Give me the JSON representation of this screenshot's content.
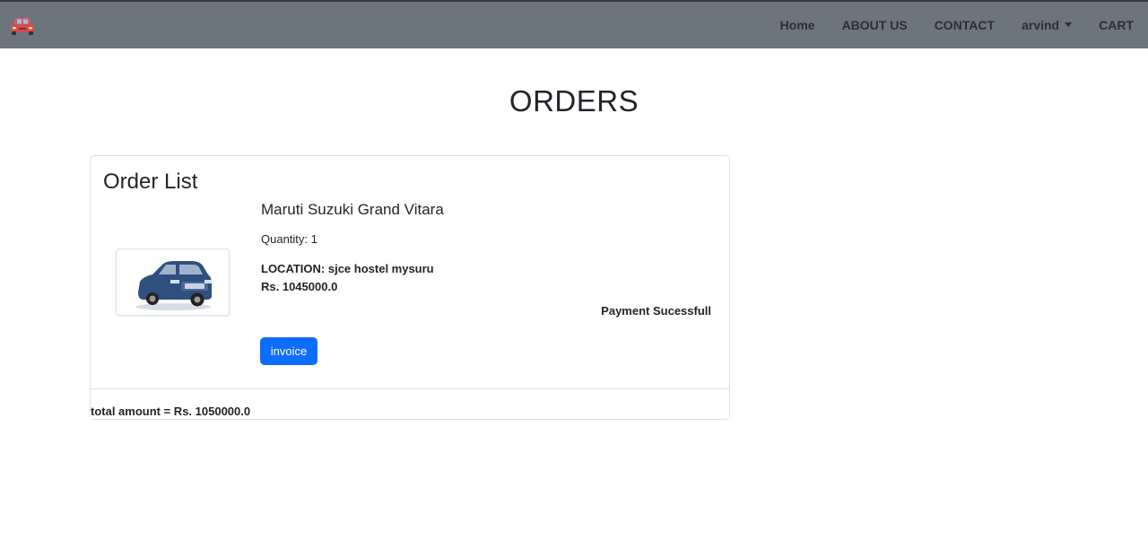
{
  "nav": {
    "brand_icon": "car-logo-icon",
    "items": [
      {
        "label": "Home"
      },
      {
        "label": "ABOUT US"
      },
      {
        "label": "CONTACT"
      },
      {
        "label": "arvind"
      },
      {
        "label": "CART"
      }
    ]
  },
  "page": {
    "title": "ORDERS"
  },
  "order_list": {
    "title": "Order List",
    "items": [
      {
        "product_name": "Maruti Suzuki Grand Vitara",
        "image_icon": "car-image",
        "quantity": "Quantity: 1",
        "location": "LOCATION: sjce hostel mysuru",
        "price": "Rs. 1045000.0",
        "status": "Payment Sucessfull",
        "invoice_label": "invoice"
      }
    ],
    "total": "total amount = Rs. 1050000.0"
  },
  "colors": {
    "navbar_bg": "#6c757d",
    "button_primary": "#0d6efd"
  }
}
